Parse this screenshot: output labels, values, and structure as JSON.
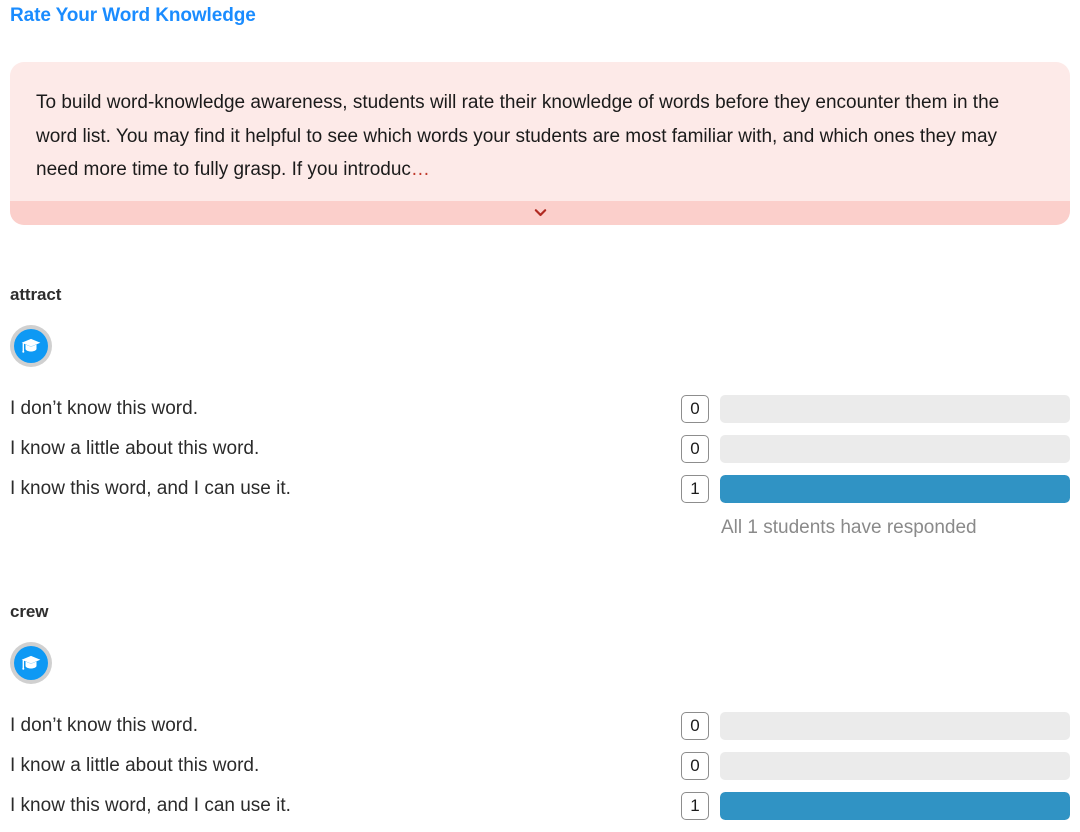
{
  "header": {
    "title": "Rate Your Word Knowledge",
    "title_color": "#1a8cff"
  },
  "info_banner": {
    "text": "To build word-knowledge awareness, students will rate their knowledge of words before they encounter them in the word list. You may find it helpful to see which words your students are most familiar with, and which ones they may need more time to fully grasp. If you introduc",
    "truncation_ellipsis": "…",
    "background_color": "#fdeae8",
    "footer_color": "#fbcfcb",
    "expand_icon": "chevron-down-icon",
    "expand_icon_color": "#b02a22"
  },
  "colors": {
    "bar_fill": "#3093c4",
    "bar_track": "#ebebeb",
    "badge_ring": "#d0d0d0",
    "badge_fill": "#0e99f4",
    "note_text": "#8a8a8a"
  },
  "words": [
    {
      "word": "attract",
      "badge_icon": "graduation-cap-icon",
      "choices": [
        {
          "label": "I don’t know this word.",
          "count": "0",
          "percent": 0
        },
        {
          "label": "I know a little about this word.",
          "count": "0",
          "percent": 0
        },
        {
          "label": "I know this word, and I can use it.",
          "count": "1",
          "percent": 100
        }
      ],
      "responded_note": "All 1 students have responded"
    },
    {
      "word": "crew",
      "badge_icon": "graduation-cap-icon",
      "choices": [
        {
          "label": "I don’t know this word.",
          "count": "0",
          "percent": 0
        },
        {
          "label": "I know a little about this word.",
          "count": "0",
          "percent": 0
        },
        {
          "label": "I know this word, and I can use it.",
          "count": "1",
          "percent": 100
        }
      ],
      "responded_note": ""
    }
  ]
}
